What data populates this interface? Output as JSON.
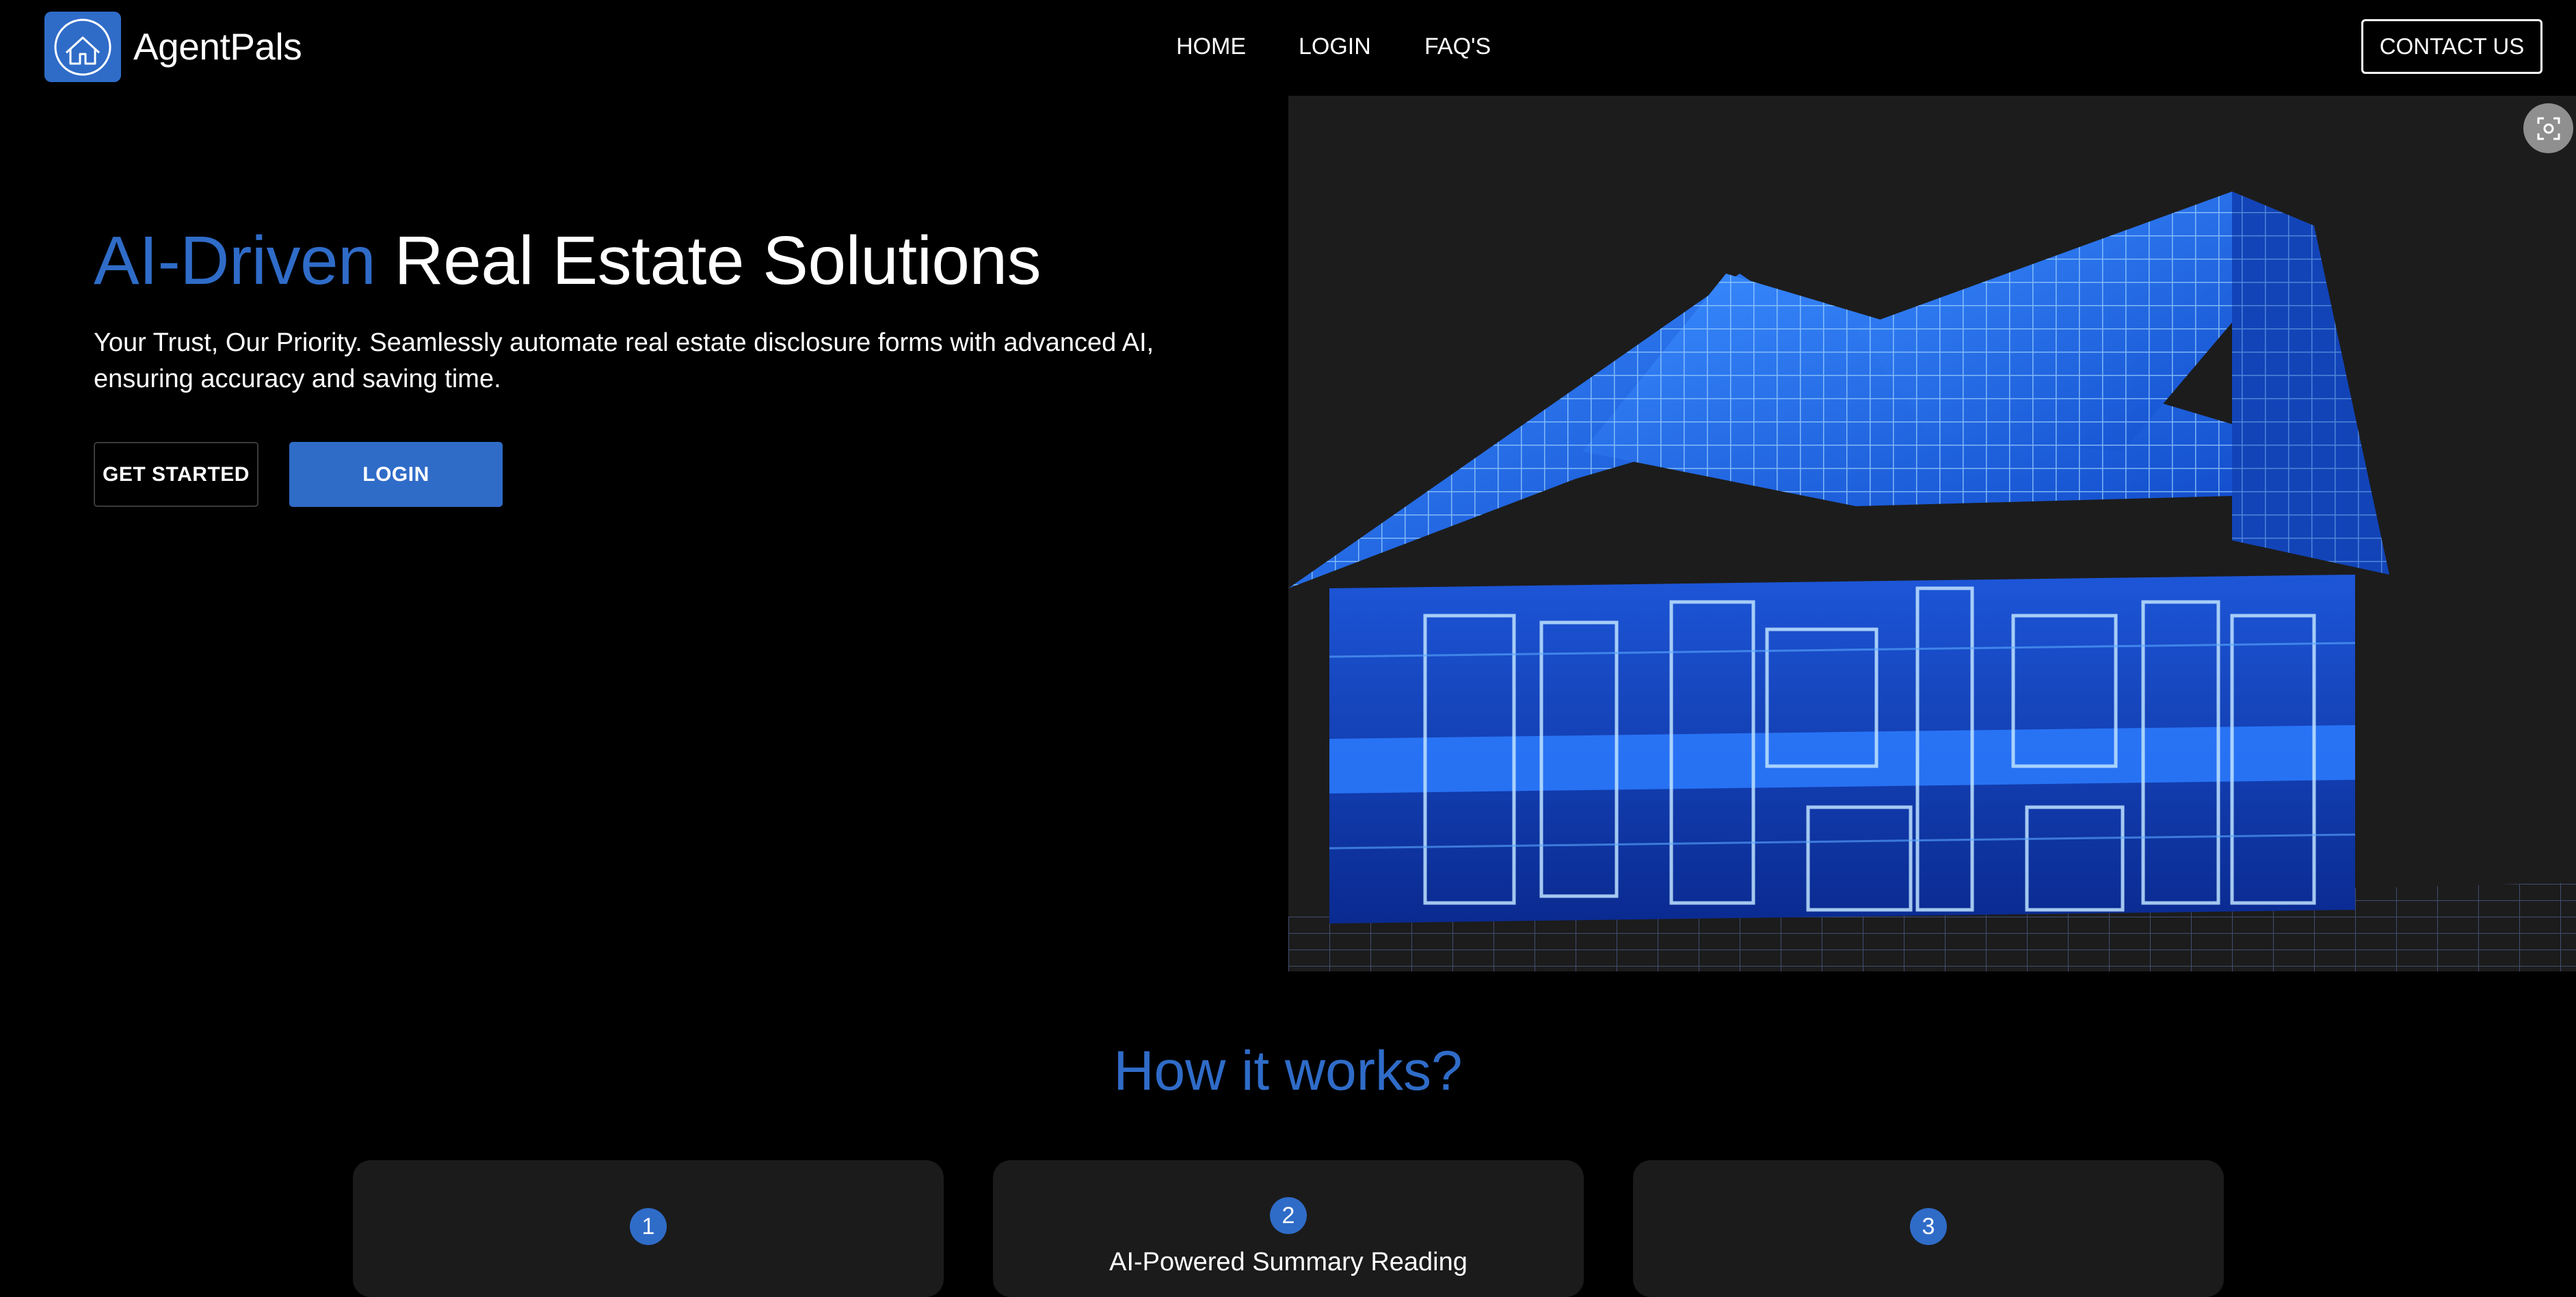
{
  "header": {
    "brand": "AgentPals",
    "nav": [
      {
        "label": "HOME"
      },
      {
        "label": "LOGIN"
      },
      {
        "label": "FAQ'S"
      }
    ],
    "contact_label": "CONTACT US"
  },
  "hero": {
    "title_accent": "AI-Driven",
    "title_rest": " Real Estate Solutions",
    "subtitle": "Your Trust, Our Priority. Seamlessly automate real estate disclosure forms with advanced AI, ensuring accuracy and saving time.",
    "get_started_label": "GET STARTED",
    "login_label": "LOGIN",
    "image_icon": "wireframe-house-image"
  },
  "how_it_works": {
    "title": "How it works?",
    "steps": [
      {
        "number": "1",
        "text": ""
      },
      {
        "number": "2",
        "text": "AI-Powered Summary Reading"
      },
      {
        "number": "3",
        "text": ""
      }
    ]
  },
  "colors": {
    "accent": "#2f6cc8",
    "background": "#000000",
    "card": "#1b1b1b"
  }
}
